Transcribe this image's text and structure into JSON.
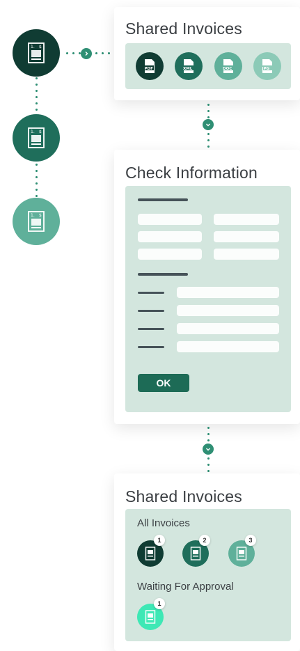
{
  "colors": {
    "accent": "#2f8f74",
    "panel": "#d3e6de",
    "dark": "#0f3b31"
  },
  "shared_card": {
    "title": "Shared Invoices",
    "formats": [
      {
        "label": "PDF",
        "icon": "pdf-file-icon",
        "color": "#103c33"
      },
      {
        "label": "XML",
        "icon": "xml-file-icon",
        "color": "#1f6e5b"
      },
      {
        "label": "DOC",
        "icon": "doc-file-icon",
        "color": "#5fb09a"
      },
      {
        "label": "JPG",
        "icon": "jpg-file-icon",
        "color": "#8ccab7"
      }
    ]
  },
  "check_card": {
    "title": "Check Information",
    "ok_label": "OK"
  },
  "approval_card": {
    "title": "Shared Invoices",
    "all_label": "All Invoices",
    "all_badges": [
      "1",
      "2",
      "3"
    ],
    "waiting_label": "Waiting For Approval",
    "waiting_badges": [
      "1"
    ]
  }
}
